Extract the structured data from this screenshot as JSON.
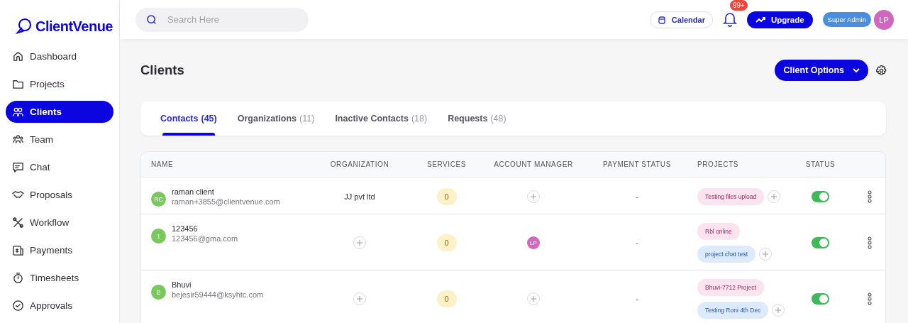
{
  "logo": {
    "text": "ClientVenue"
  },
  "sidebar": {
    "items": [
      {
        "label": "Dashboard",
        "selected": false
      },
      {
        "label": "Projects",
        "selected": false
      },
      {
        "label": "Clients",
        "selected": true
      },
      {
        "label": "Team",
        "selected": false
      },
      {
        "label": "Chat",
        "selected": false
      },
      {
        "label": "Proposals",
        "selected": false
      },
      {
        "label": "Workflow",
        "selected": false
      },
      {
        "label": "Payments",
        "selected": false
      },
      {
        "label": "Timesheets",
        "selected": false
      },
      {
        "label": "Approvals",
        "selected": false
      }
    ]
  },
  "topbar": {
    "search": {
      "placeholder": "Search Here"
    },
    "calendar": "Calendar",
    "notifications": "99+",
    "upgrade": "Upgrade",
    "role": "Super Admin",
    "user_initials": "LP"
  },
  "page": {
    "title": "Clients",
    "options_button": "Client Options"
  },
  "tabs": [
    {
      "label": "Contacts",
      "count": "(45)",
      "selected": true
    },
    {
      "label": "Organizations",
      "count": "(11)",
      "selected": false
    },
    {
      "label": "Inactive Contacts",
      "count": "(18)",
      "selected": false
    },
    {
      "label": "Requests",
      "count": "(48)",
      "selected": false
    }
  ],
  "table": {
    "columns": [
      "NAME",
      "ORGANIZATION",
      "SERVICES",
      "ACCOUNT MANAGER",
      "PAYMENT STATUS",
      "PROJECTS",
      "STATUS"
    ],
    "rows": [
      {
        "initials": "RC",
        "name": "raman client",
        "email": "raman+3855@clientvenue.com",
        "organization": "JJ pvt ltd",
        "services": "0",
        "manager": null,
        "payment_status": "-",
        "projects": [
          {
            "name": "Testing files upload",
            "color": "#fce4ef"
          }
        ],
        "status_on": true
      },
      {
        "initials": "1",
        "name": "123456",
        "email": "123456@gma.com",
        "organization": null,
        "services": "0",
        "manager": "LP",
        "payment_status": "-",
        "projects": [
          {
            "name": "Rbl online",
            "color": "#fce4ef"
          },
          {
            "name": "project chat test",
            "color": "#dde9fd"
          }
        ],
        "status_on": true
      },
      {
        "initials": "B",
        "name": "Bhuvi",
        "email": "bejesir59444@ksyhtc.com",
        "organization": null,
        "services": "0",
        "manager": null,
        "payment_status": "-",
        "projects": [
          {
            "name": "Bhuvi-7712 Project",
            "color": "#fce4ef"
          },
          {
            "name": "Testing Roni 4th Dec",
            "color": "#dde9fd"
          }
        ],
        "status_on": true
      }
    ]
  }
}
